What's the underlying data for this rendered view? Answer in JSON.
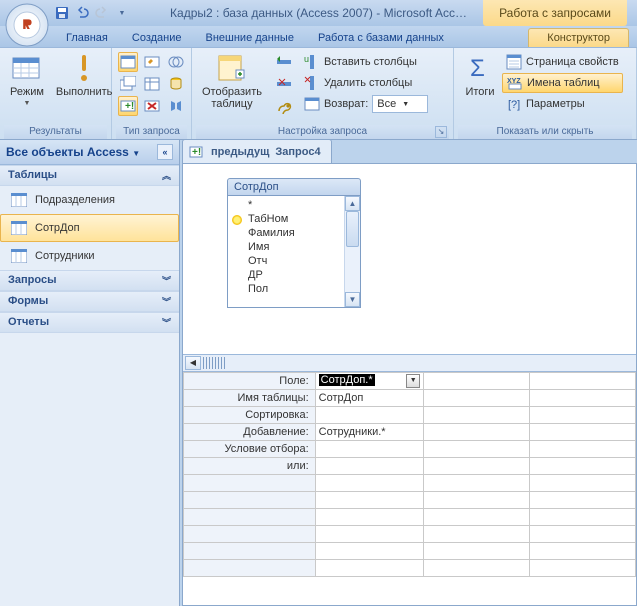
{
  "titlebar": {
    "title": "Кадры2 : база данных (Access 2007) - Microsoft Acc…",
    "context_title": "Работа с запросами"
  },
  "tabs": {
    "home": "Главная",
    "create": "Создание",
    "external": "Внешние данные",
    "dbtools": "Работа с базами данных",
    "context": "Конструктор"
  },
  "ribbon": {
    "g1": {
      "label": "Результаты",
      "view": "Режим",
      "run": "Выполнить"
    },
    "g2": {
      "label": "Тип запроса"
    },
    "g3": {
      "label": "Настройка запроса",
      "showtable_l1": "Отобразить",
      "showtable_l2": "таблицу",
      "insert_cols": "Вставить столбцы",
      "delete_cols": "Удалить столбцы",
      "return_lbl": "Возврат:",
      "return_val": "Все"
    },
    "g4": {
      "label": "Показать или скрыть",
      "totals": "Итоги",
      "propsheet": "Страница свойств",
      "tablenames": "Имена таблиц",
      "params": "Параметры"
    }
  },
  "nav": {
    "header": "Все объекты Access",
    "g_tables": "Таблицы",
    "g_queries": "Запросы",
    "g_forms": "Формы",
    "g_reports": "Отчеты",
    "tables": {
      "t0": "Подразделения",
      "t1": "СотрДоп",
      "t2": "Сотрудники"
    }
  },
  "doc": {
    "tab": "Запрос4",
    "tablebox": {
      "title": "СотрДоп",
      "fields": {
        "star": "*",
        "f0": "ТабНом",
        "f1": "Фамилия",
        "f2": "Имя",
        "f3": "Отч",
        "f4": "ДР",
        "f5": "Пол"
      }
    }
  },
  "qbe": {
    "labels": {
      "field": "Поле:",
      "table": "Имя таблицы:",
      "sort": "Сортировка:",
      "append": "Добавление:",
      "criteria": "Условие отбора:",
      "or": "или:"
    },
    "col0": {
      "field": "СотрДоп.*",
      "table": "СотрДоп",
      "append": "Сотрудники.*"
    }
  }
}
